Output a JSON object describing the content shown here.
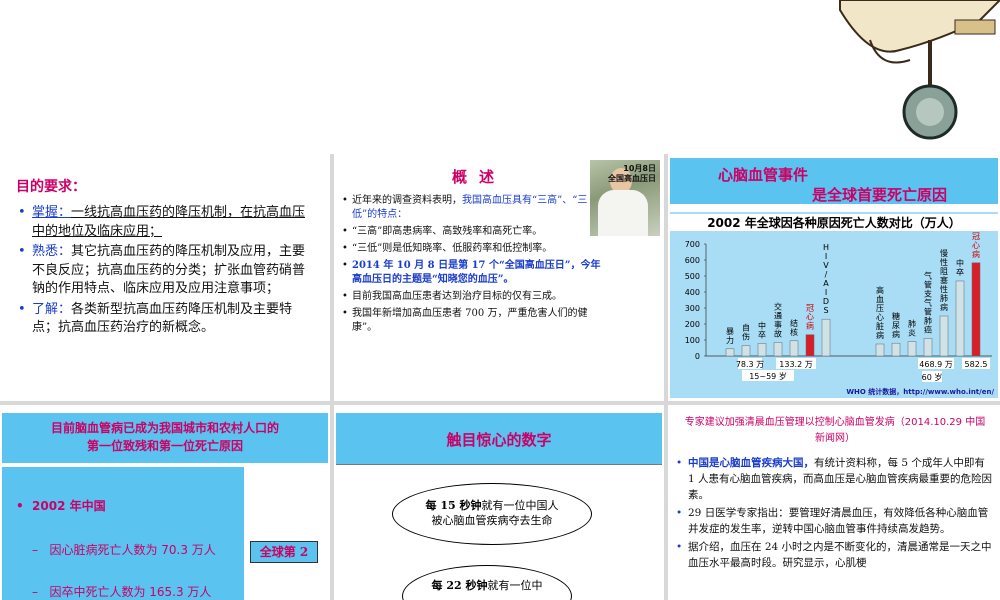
{
  "objectives": {
    "title": "目的要求：",
    "items": [
      {
        "key": "掌握：",
        "text": "一线抗高血压药的降压机制，在抗高血压中的地位及临床应用；"
      },
      {
        "key": "熟悉：",
        "text": "其它抗高血压药的降压机制及应用，主要不良反应；抗高血压药的分类；扩张血管药硝普钠的作用特点、临床应用及应用注意事项；"
      },
      {
        "key": "了解：",
        "text": "各类新型抗高血压药降压机制及主要特点；抗高血压药治疗的新概念。"
      }
    ]
  },
  "overview": {
    "title": "概述",
    "photo_caption_1": "10月8日",
    "photo_caption_2": "全国高血压日",
    "items": [
      {
        "pre": "近年来的调查资料表明，",
        "hl": "我国高血压具有“三高”、“三低”的特点：",
        "post": ""
      },
      {
        "pre": "“三高”即高患病率、高致残率和高死亡率。",
        "hl": "",
        "post": ""
      },
      {
        "pre": "“三低”则是低知晓率、低服药率和低控制率。",
        "hl": "",
        "post": ""
      },
      {
        "pre": "",
        "hl": "2014 年 10 月 8 日是第 17 个“全国高血压日”，今年高血压日的主题是“知晓您的血压”。",
        "post": ""
      },
      {
        "pre": "目前我国高血压患者达到治疗目标的仅有三成。",
        "hl": "",
        "post": ""
      },
      {
        "pre": "我国年新增加高血压患者 700 万，严重危害人们的健康”。",
        "hl": "",
        "post": ""
      }
    ]
  },
  "global_events": {
    "title_1": "心脑血管事件",
    "title_2": "是全球首要死亡原因",
    "chart_title": "2002 年全球因各种原因死亡人数对比（万人）",
    "source": "WHO 统计数据，http://www.who.int/en/",
    "ann_left_1": "78.3 万",
    "ann_left_2": "133.2 万",
    "ann_age_1": "15~59 岁",
    "ann_right_1": "468.9 万",
    "ann_right_2": "582.5",
    "ann_age_2": "60 岁"
  },
  "chart_data": {
    "type": "bar",
    "title": "2002 年全球因各种原因死亡人数对比（万人）",
    "ylim": [
      0,
      700
    ],
    "yticks": [
      0,
      100,
      200,
      300,
      400,
      500,
      600,
      700
    ],
    "groups": [
      {
        "age": "15~59 岁",
        "labels": [
          "暴力",
          "自伤",
          "中卒",
          "交通事故",
          "结核",
          "冠心病",
          "HIV/AIDS"
        ],
        "values": [
          45,
          65,
          78.3,
          85,
          95,
          133.2,
          230
        ],
        "highlight": [
          false,
          false,
          false,
          false,
          false,
          true,
          false
        ]
      },
      {
        "age": "60 岁",
        "labels": [
          "高血压心脏病",
          "糖尿病",
          "肺炎",
          "气管支气管肺癌",
          "慢性阻塞性肺病",
          "中卒",
          "冠心病"
        ],
        "values": [
          75,
          80,
          90,
          110,
          250,
          468.9,
          582.5
        ],
        "highlight": [
          false,
          false,
          false,
          false,
          false,
          false,
          true
        ]
      }
    ]
  },
  "china": {
    "head_1": "目前脑血管病已成为我国城市和农村人口的",
    "head_2": "第一位致残和第一位死亡原因",
    "year": "2002 年中国",
    "row_1": "因心脏病死亡人数为 70.3 万人",
    "row_2": "因卒中死亡人数为 165.3 万人",
    "tag_1": "全球第 2"
  },
  "numbers": {
    "title": "触目惊心的数字",
    "cloud_1a": "每 15 秒钟",
    "cloud_1b": "就有一位中国人",
    "cloud_1c": "被心脑血管疾病夺去生命",
    "cloud_2a": "每 22 秒钟",
    "cloud_2b": "就有一位中"
  },
  "expert": {
    "title": "专家建议加强清晨血压管理以控制心脑血管发病（2014.10.29 中国新闻网）",
    "items": [
      {
        "hl": "中国是心脑血管疾病大国，",
        "text": "有统计资料称，每 5 个成年人中即有 1 人患有心脑血管疾病，而高血压是心脑血管疾病最重要的危险因素。"
      },
      {
        "hl": "",
        "text": "29 日医学专家指出：要管理好清晨血压，有效降低各种心脑血管并发症的发生率，逆转中国心脑血管事件持续高发趋势。"
      },
      {
        "hl": "",
        "text": "据介绍，血压在 24 小时之内是不断变化的，清晨通常是一天之中血压水平最高时段。研究显示，心肌梗"
      }
    ]
  }
}
